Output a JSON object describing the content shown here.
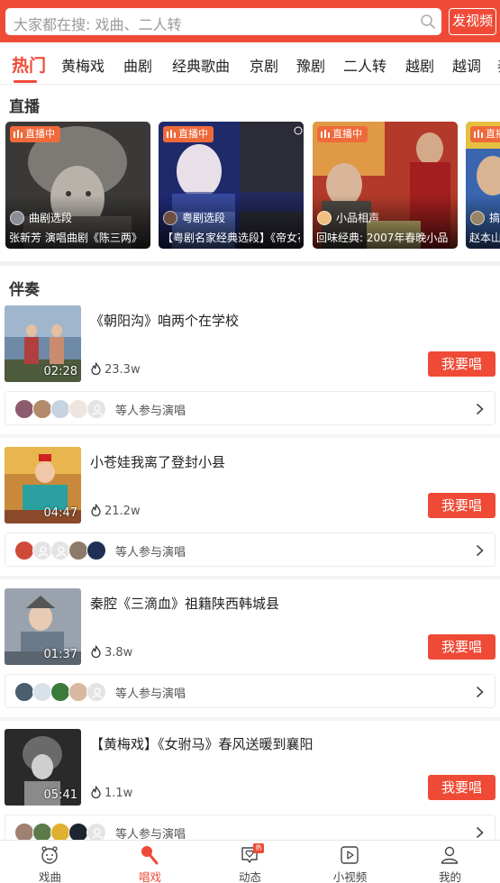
{
  "search": {
    "placeholder": "大家都在搜: 戏曲、二人转",
    "upload_label": "发视频"
  },
  "tabs": [
    {
      "label": "热门",
      "active": true
    },
    {
      "label": "黄梅戏"
    },
    {
      "label": "曲剧"
    },
    {
      "label": "经典歌曲"
    },
    {
      "label": "京剧"
    },
    {
      "label": "豫剧"
    },
    {
      "label": "二人转"
    },
    {
      "label": "越剧"
    },
    {
      "label": "越调"
    },
    {
      "label": "秦"
    }
  ],
  "live": {
    "section_title": "直播",
    "badge": "直播中",
    "cards": [
      {
        "category": "曲剧选段",
        "title": "张新芳 演唱曲剧《陈三两》"
      },
      {
        "category": "粤剧选段",
        "title": "【粤剧名家经典选段】《帝女花》"
      },
      {
        "category": "小品相声",
        "title": "回味经典: 2007年春晚小品"
      },
      {
        "category": "搞笑",
        "title": "赵本山"
      }
    ]
  },
  "accompany": {
    "section_title": "伴奏",
    "sing_label": "我要唱",
    "participants_text": "等人参与演唱",
    "songs": [
      {
        "title": "《朝阳沟》咱两个在学校",
        "duration": "02:28",
        "plays": "23.3w"
      },
      {
        "title": "小苍娃我离了登封小县",
        "duration": "04:47",
        "plays": "21.2w"
      },
      {
        "title": "秦腔《三滴血》祖籍陕西韩城县",
        "duration": "01:37",
        "plays": "3.8w"
      },
      {
        "title": "【黄梅戏】《女驸马》春风送暖到襄阳",
        "duration": "05:41",
        "plays": "1.1w"
      }
    ]
  },
  "bottom_nav": [
    {
      "label": "戏曲",
      "icon": "opera-mask-icon"
    },
    {
      "label": "唱戏",
      "icon": "microphone-icon",
      "active": true
    },
    {
      "label": "动态",
      "icon": "heart-speech-icon",
      "badge": "热"
    },
    {
      "label": "小视频",
      "icon": "play-square-icon"
    },
    {
      "label": "我的",
      "icon": "user-icon"
    }
  ],
  "colors": {
    "accent": "#ef4a36",
    "badge": "#ef6a3a"
  }
}
